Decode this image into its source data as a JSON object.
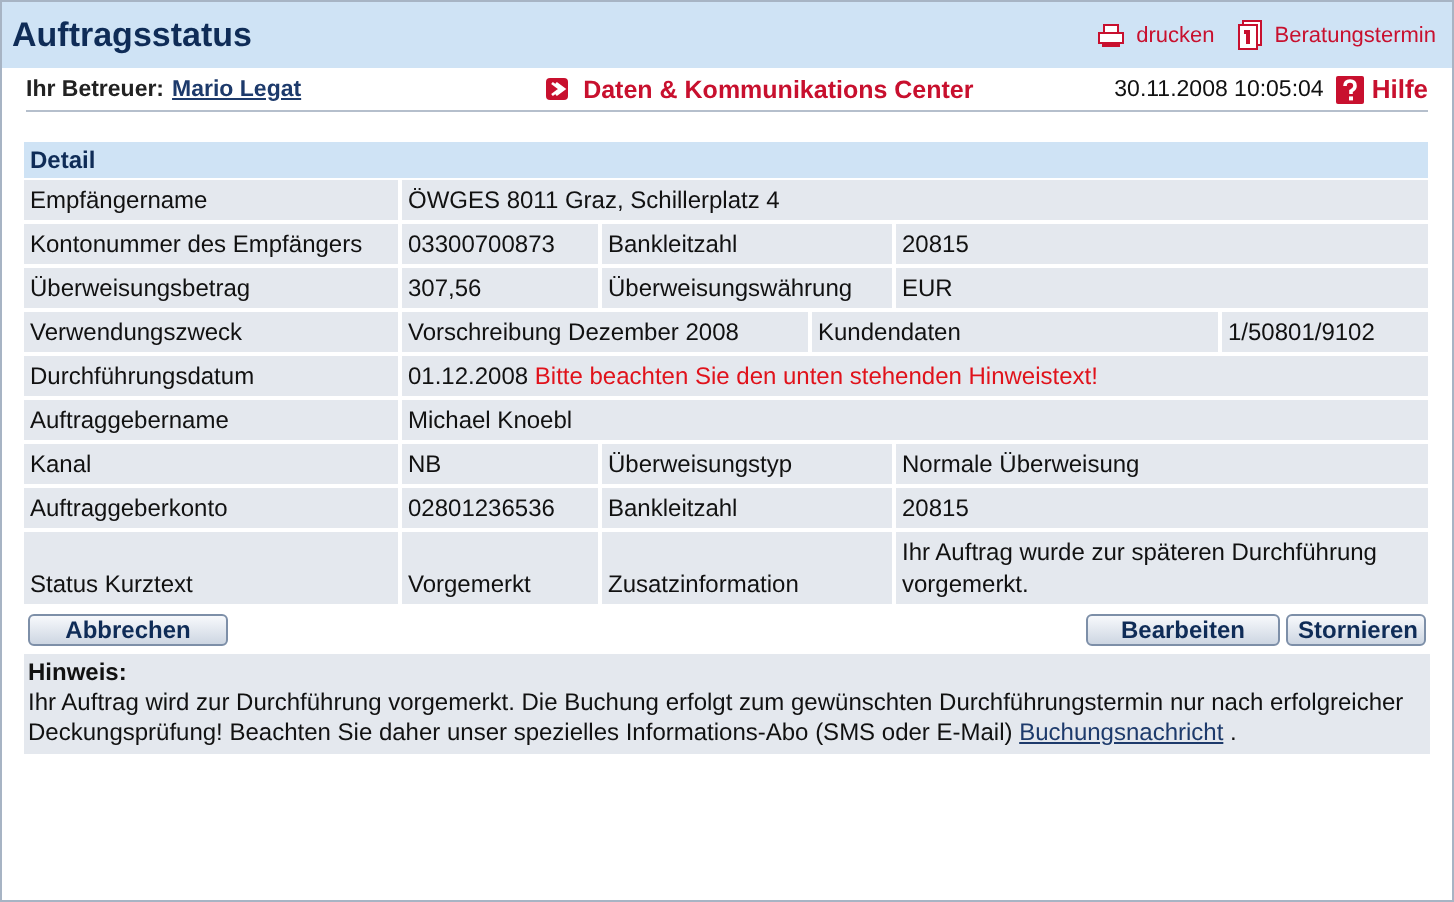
{
  "header": {
    "title": "Auftragsstatus",
    "actions": [
      {
        "kind": "print",
        "label": "drucken"
      },
      {
        "kind": "calendar",
        "label": "Beratungstermin"
      }
    ]
  },
  "infobar": {
    "advisor_label": "Ihr Betreuer:",
    "advisor_name": "Mario Legat",
    "center_link": "Daten & Kommunikations Center",
    "datetime": "30.11.2008 10:05:04",
    "help": "Hilfe"
  },
  "detail": {
    "title": "Detail",
    "rows": [
      {
        "kind": "single",
        "label": "Empfängername",
        "value": "ÖWGES 8011 Graz, Schillerplatz 4"
      },
      {
        "kind": "pair",
        "label": "Kontonummer des Empfängers",
        "value": "03300700873",
        "label_2": "Bankleitzahl",
        "value_2": "20815"
      },
      {
        "kind": "pair",
        "label": "Überweisungsbetrag",
        "value": "307,56",
        "label_2": "Überweisungswährung",
        "value_2": "EUR"
      },
      {
        "kind": "wide",
        "label": "Verwendungszweck",
        "value": "Vorschreibung Dezember 2008",
        "label_2": "Kundendaten",
        "value_2": "1/50801/9102"
      },
      {
        "kind": "note",
        "label": "Durchführungsdatum",
        "value": "01.12.2008",
        "note": "Bitte beachten Sie den unten stehenden Hinweistext!"
      },
      {
        "kind": "single",
        "label": "Auftraggebername",
        "value": "Michael Knoebl"
      },
      {
        "kind": "pair",
        "label": "Kanal",
        "value": "NB",
        "label_2": "Überweisungstyp",
        "value_2": "Normale Überweisung"
      },
      {
        "kind": "pair",
        "label": "Auftraggeberkonto",
        "value": "02801236536",
        "label_2": "Bankleitzahl",
        "value_2": "20815"
      },
      {
        "kind": "tall",
        "label": "Status Kurztext",
        "value": "Vorgemerkt",
        "label_2": "Zusatzinformation",
        "value_2": "Ihr Auftrag wurde zur späteren Durchführung vorgemerkt."
      }
    ]
  },
  "buttons": {
    "left": [
      "Abbrechen"
    ],
    "right": [
      "Bearbeiten",
      "Stornieren"
    ]
  },
  "hint": {
    "title": "Hinweis:",
    "text": "Ihr Auftrag wird zur Durchführung vorgemerkt. Die Buchung erfolgt zum gewünschten Durchführungstermin nur nach erfolgreicher Deckungsprüfung! Beachten Sie daher unser spezielles Informations-Abo (SMS oder E-Mail) ",
    "link": "Buchungsnachricht",
    "text_after": " ."
  }
}
